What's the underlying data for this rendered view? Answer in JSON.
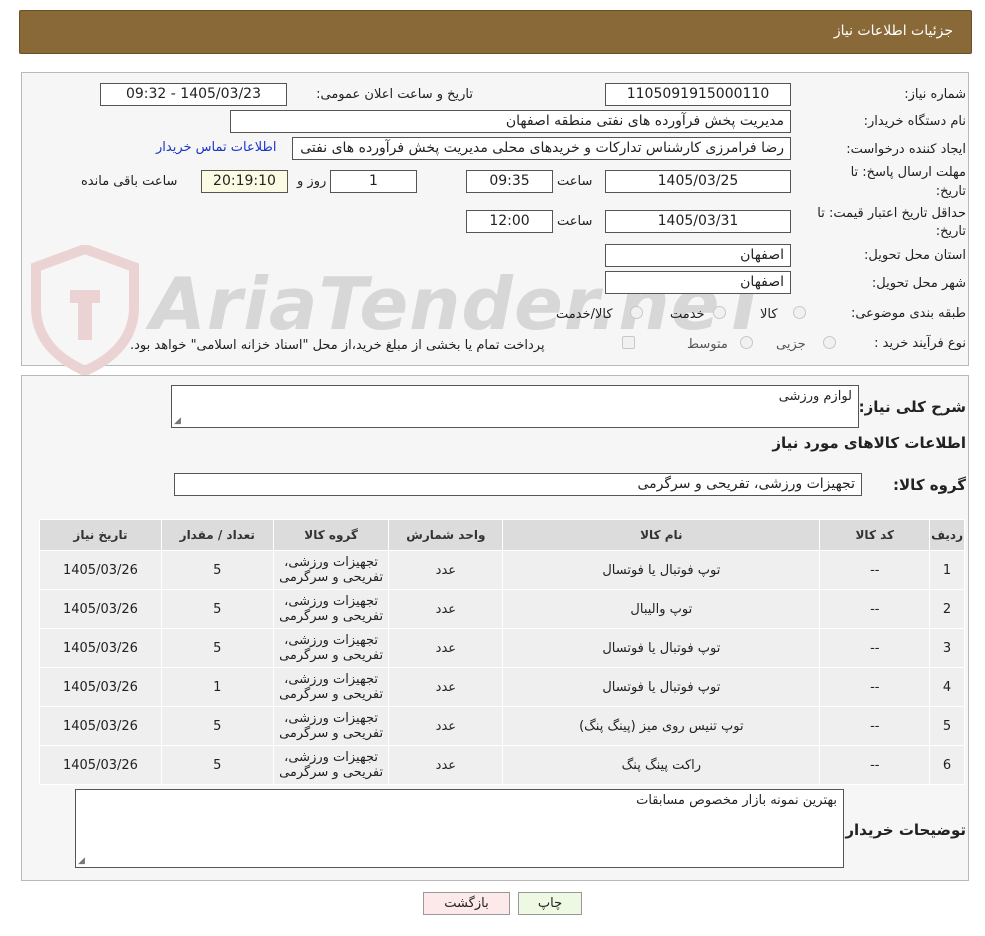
{
  "window_title": "جزئیات اطلاعات نیاز",
  "watermark": "AriaTender.neT",
  "fields": {
    "need_number_label": "شماره نیاز:",
    "need_number": "1105091915000110",
    "announce_label": "تاریخ و ساعت اعلان عمومی:",
    "announce_value": "1405/03/23 - 09:32",
    "buyer_label": "نام دستگاه خریدار:",
    "buyer": "مدیریت پخش فرآورده های نفتی منطقه اصفهان",
    "creator_label": "ایجاد کننده درخواست:",
    "creator": "رضا فرامرزی کارشناس تدارکات و خریدهای محلی مدیریت پخش فرآورده های نفتی",
    "contact_link": "اطلاعات تماس خریدار",
    "deadline_label_1": "مهلت ارسال پاسخ: تا",
    "deadline_label_2": "تاریخ:",
    "deadline_date": "1405/03/25",
    "time_label": "ساعت",
    "deadline_time": "09:35",
    "days_count": "1",
    "days_label": "روز و",
    "remaining_time": "20:19:10",
    "remaining_label": "ساعت باقی مانده",
    "validity_label_1": "حداقل تاریخ اعتبار قیمت: تا",
    "validity_label_2": "تاریخ:",
    "validity_date": "1405/03/31",
    "validity_time": "12:00",
    "province_label": "استان محل تحویل:",
    "province": "اصفهان",
    "city_label": "شهر محل تحویل:",
    "city": "اصفهان",
    "category_label": "طبقه بندی موضوعی:",
    "category_options": [
      "کالا",
      "خدمت",
      "کالا/خدمت"
    ],
    "process_label": "نوع فرآیند خرید :",
    "process_options": [
      "جزیی",
      "متوسط"
    ],
    "payment_note": "پرداخت تمام یا بخشی از مبلغ خرید،از محل \"اسناد خزانه اسلامی\" خواهد بود."
  },
  "summary": {
    "label": "شرح کلی نیاز:",
    "value": "لوازم ورزشی",
    "items_heading": "اطلاعات کالاهای مورد نیاز",
    "group_label": "گروه کالا:",
    "group_value": "تجهیزات ورزشی، تفریحی و سرگرمی"
  },
  "table": {
    "headers": [
      "ردیف",
      "کد کالا",
      "نام کالا",
      "واحد شمارش",
      "گروه کالا",
      "تعداد / مقدار",
      "تاریخ نیاز"
    ],
    "rows": [
      [
        "1",
        "--",
        "توپ فوتبال یا فوتسال",
        "عدد",
        "تجهیزات ورزشی، تفریحی و سرگرمی",
        "5",
        "1405/03/26"
      ],
      [
        "2",
        "--",
        "توپ والیبال",
        "عدد",
        "تجهیزات ورزشی، تفریحی و سرگرمی",
        "5",
        "1405/03/26"
      ],
      [
        "3",
        "--",
        "توپ فوتبال یا فوتسال",
        "عدد",
        "تجهیزات ورزشی، تفریحی و سرگرمی",
        "5",
        "1405/03/26"
      ],
      [
        "4",
        "--",
        "توپ فوتبال یا فوتسال",
        "عدد",
        "تجهیزات ورزشی، تفریحی و سرگرمی",
        "1",
        "1405/03/26"
      ],
      [
        "5",
        "--",
        "توپ تنیس روی میز (پینگ پنگ)",
        "عدد",
        "تجهیزات ورزشی، تفریحی و سرگرمی",
        "5",
        "1405/03/26"
      ],
      [
        "6",
        "--",
        "راکت پینگ پنگ",
        "عدد",
        "تجهیزات ورزشی، تفریحی و سرگرمی",
        "5",
        "1405/03/26"
      ]
    ]
  },
  "buyer_notes": {
    "label": "توضیحات خریدار:",
    "value": "بهترین نمونه بازار مخصوص مسابقات"
  },
  "buttons": {
    "print": "چاپ",
    "back": "بازگشت"
  }
}
